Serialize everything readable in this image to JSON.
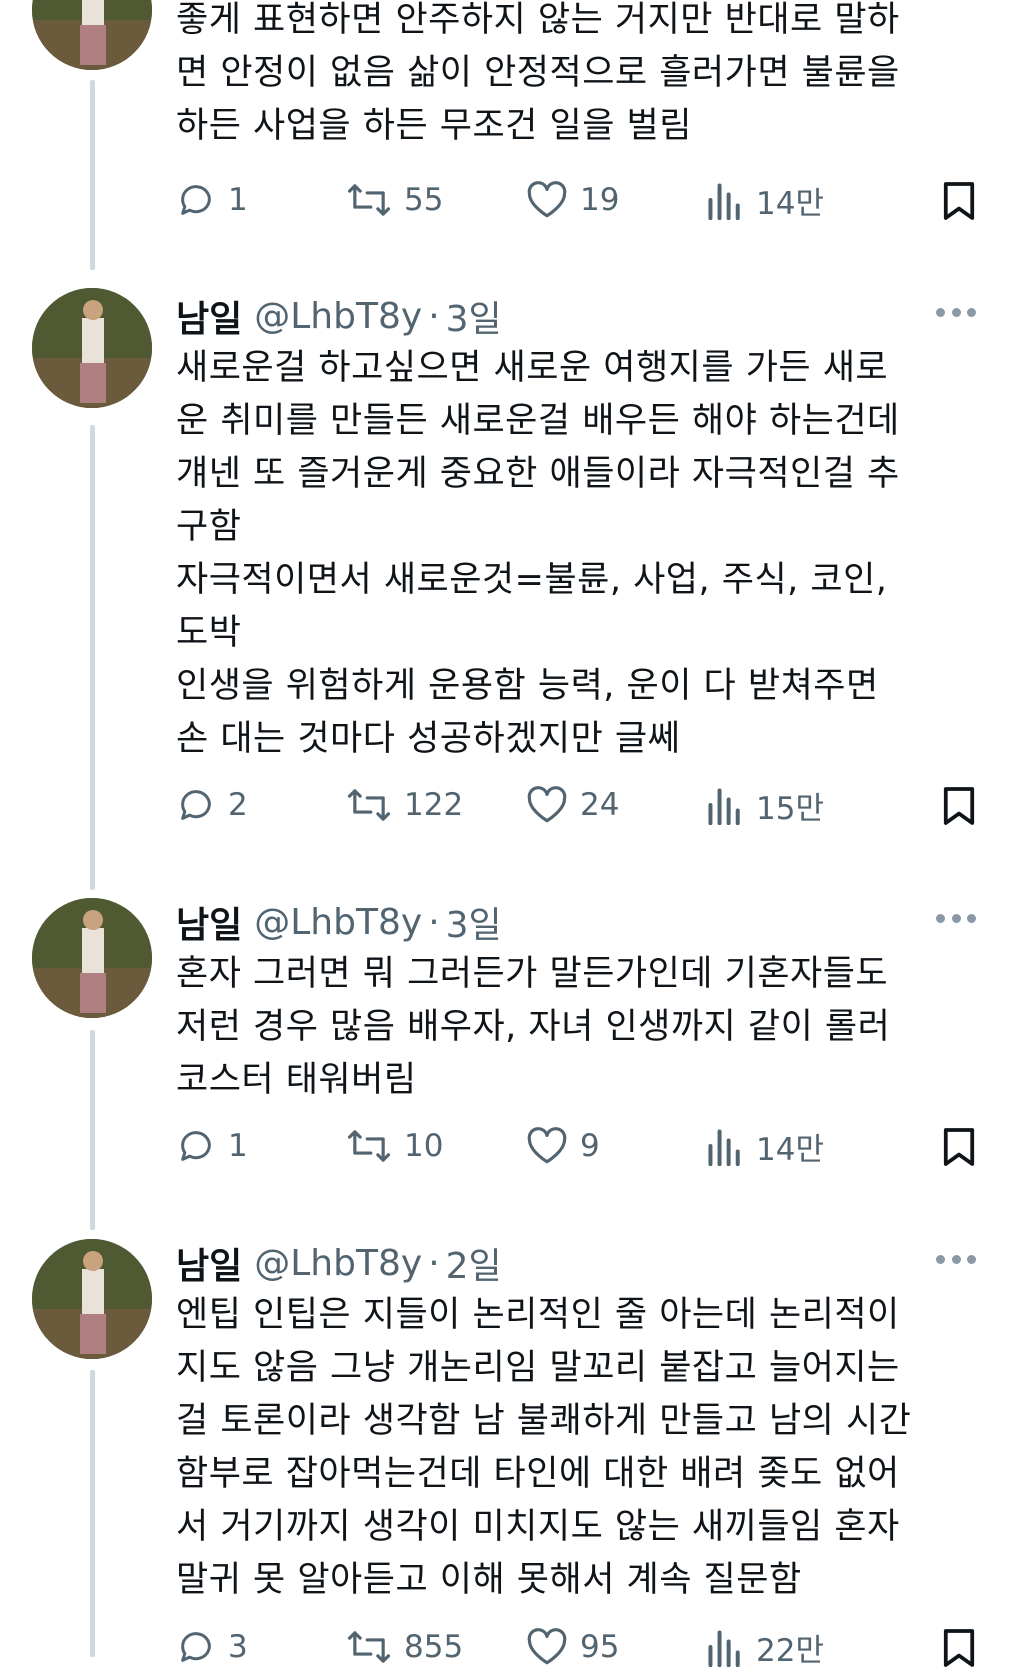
{
  "tweets": [
    {
      "name": "",
      "handle": "",
      "time": "",
      "text": "좋게 표현하면 안주하지 않는 거지만 반대로 말하\n면 안정이 없음 삶이 안정적으로 흘러가면 불륜을\n하든 사업을 하든 무조건 일을 벌림",
      "replies": "1",
      "retweets": "55",
      "likes": "19",
      "views": "14만"
    },
    {
      "name": "남일",
      "handle": "@LhbT8y",
      "time": "3일",
      "text": "새로운걸 하고싶으면 새로운 여행지를 가든 새로\n운 취미를 만들든 새로운걸 배우든 해야 하는건데\n걔넨 또 즐거운게 중요한 애들이라 자극적인걸 추\n구함\n자극적이면서 새로운것=불륜, 사업, 주식, 코인,\n도박\n인생을 위험하게 운용함 능력, 운이 다 받쳐주면\n손 대는 것마다 성공하겠지만 글쎄",
      "replies": "2",
      "retweets": "122",
      "likes": "24",
      "views": "15만"
    },
    {
      "name": "남일",
      "handle": "@LhbT8y",
      "time": "3일",
      "text": "혼자 그러면 뭐 그러든가 말든가인데 기혼자들도\n저런 경우 많음 배우자, 자녀 인생까지 같이 롤러\n코스터 태워버림",
      "replies": "1",
      "retweets": "10",
      "likes": "9",
      "views": "14만"
    },
    {
      "name": "남일",
      "handle": "@LhbT8y",
      "time": "2일",
      "text": "엔팁 인팁은 지들이 논리적인 줄 아는데 논리적이\n지도 않음 그냥 개논리임 말꼬리 붙잡고 늘어지는\n걸 토론이라 생각함 남 불쾌하게 만들고 남의 시간\n함부로 잡아먹는건데 타인에 대한 배려 좆도 없어\n서 거기까지 생각이 미치지도 않는 새끼들임 혼자\n말귀 못 알아듣고 이해 못해서 계속 질문함",
      "replies": "3",
      "retweets": "855",
      "likes": "95",
      "views": "22만"
    }
  ],
  "avatar_text": "남일",
  "colors": {
    "text": "#0f1419",
    "muted": "#536471",
    "thread_line": "#cfd9de"
  },
  "icons": [
    "reply-icon",
    "retweet-icon",
    "like-icon",
    "views-icon",
    "bookmark-icon",
    "more-icon"
  ]
}
